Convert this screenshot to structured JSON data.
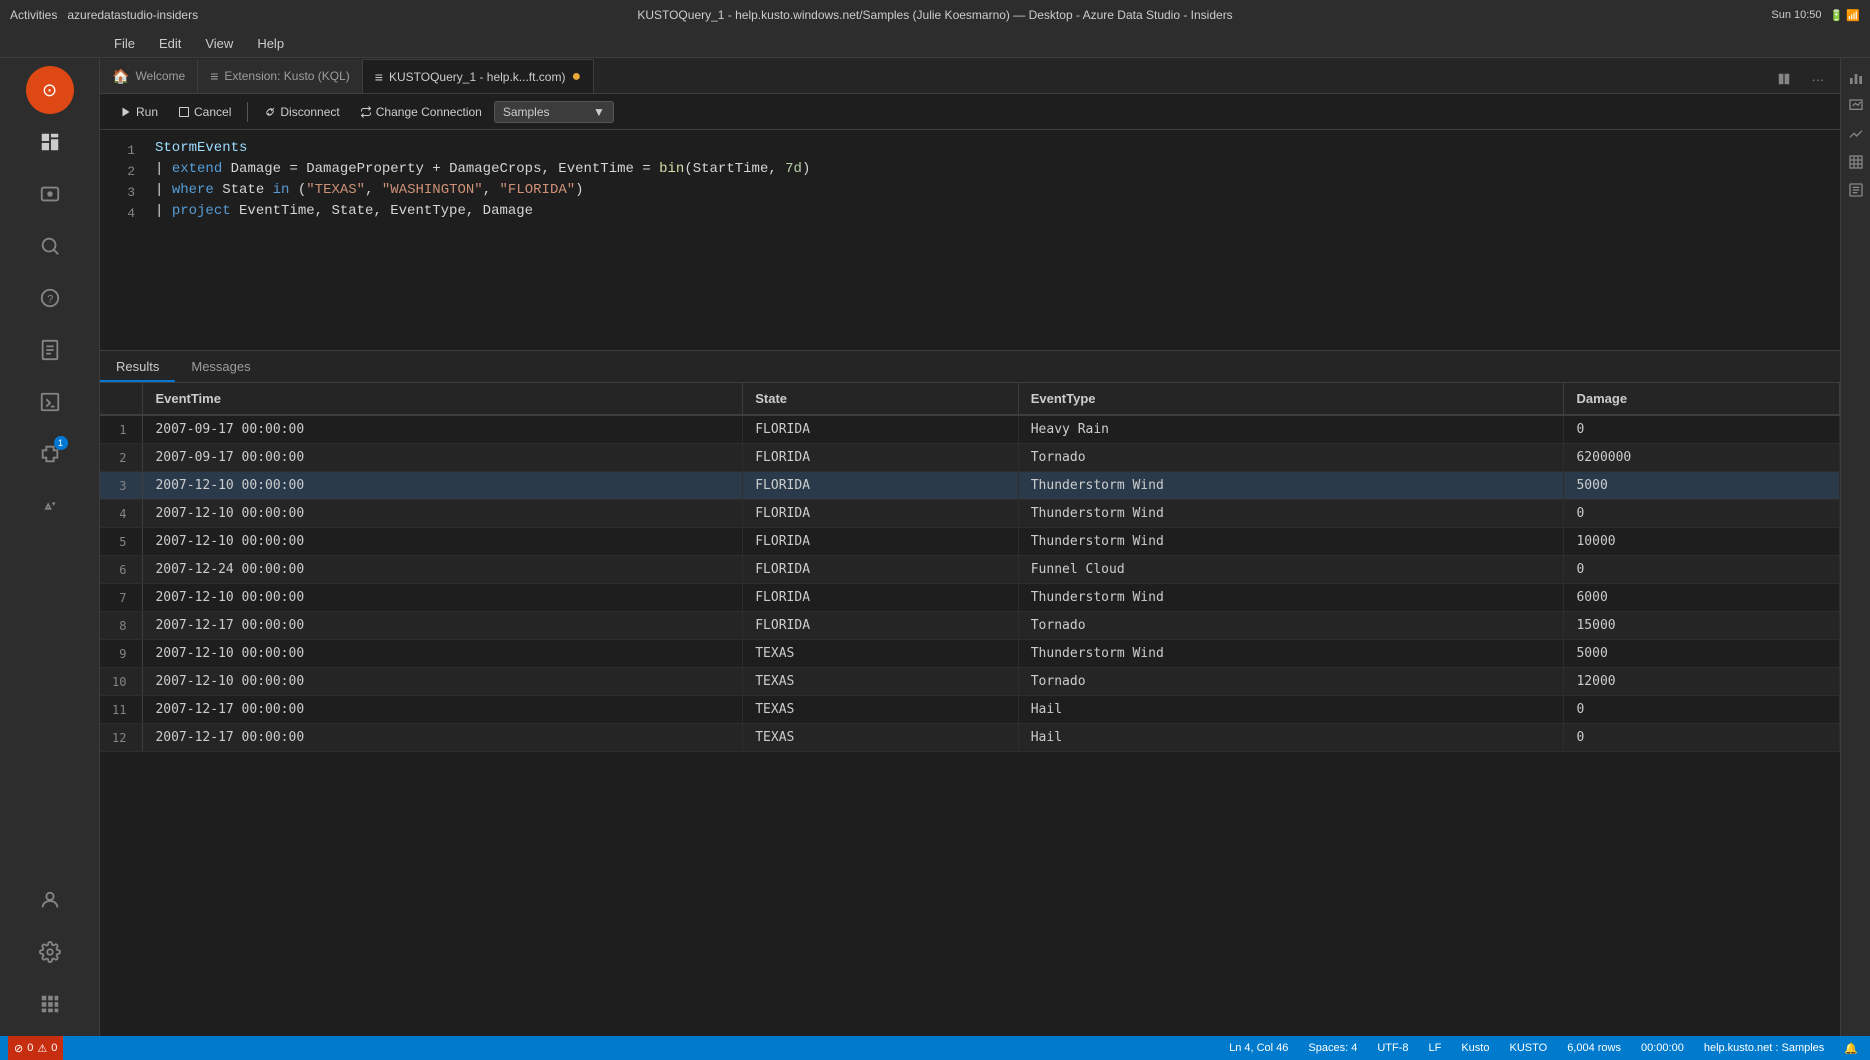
{
  "topbar": {
    "left_label": "Activities",
    "app_name": "azuredatastudio-insiders",
    "time": "Sun 10:50",
    "window_title": "KUSTOQuery_1 - help.kusto.windows.net/Samples (Julie Koesmarno) — Desktop - Azure Data Studio - Insiders"
  },
  "menu": {
    "items": [
      "File",
      "Edit",
      "View",
      "Help"
    ]
  },
  "tabs": [
    {
      "label": "Welcome",
      "icon": "🏠",
      "active": false
    },
    {
      "label": "Extension: Kusto (KQL)",
      "icon": "≡",
      "active": false
    },
    {
      "label": "KUSTOQuery_1 - help.k...ft.com)",
      "icon": "≡",
      "active": true,
      "modified": true
    }
  ],
  "toolbar": {
    "run_label": "Run",
    "cancel_label": "Cancel",
    "disconnect_label": "Disconnect",
    "change_connection_label": "Change Connection",
    "database_label": "Samples"
  },
  "code": {
    "lines": [
      {
        "num": "1",
        "content": "StormEvents"
      },
      {
        "num": "2",
        "content": "| extend Damage = DamageProperty + DamageCrops, EventTime = bin(StartTime, 7d)"
      },
      {
        "num": "3",
        "content": "| where State in (\"TEXAS\", \"WASHINGTON\", \"FLORIDA\")"
      },
      {
        "num": "4",
        "content": "| project EventTime, State, EventType, Damage"
      }
    ]
  },
  "results_tabs": [
    "Results",
    "Messages"
  ],
  "table": {
    "columns": [
      "EventTime",
      "State",
      "EventType",
      "Damage"
    ],
    "rows": [
      [
        "1",
        "2007-09-17 00:00:00",
        "FLORIDA",
        "Heavy Rain",
        "0"
      ],
      [
        "2",
        "2007-09-17 00:00:00",
        "FLORIDA",
        "Tornado",
        "6200000"
      ],
      [
        "3",
        "2007-12-10 00:00:00",
        "FLORIDA",
        "Thunderstorm Wind",
        "5000"
      ],
      [
        "4",
        "2007-12-10 00:00:00",
        "FLORIDA",
        "Thunderstorm Wind",
        "0"
      ],
      [
        "5",
        "2007-12-10 00:00:00",
        "FLORIDA",
        "Thunderstorm Wind",
        "10000"
      ],
      [
        "6",
        "2007-12-24 00:00:00",
        "FLORIDA",
        "Funnel Cloud",
        "0"
      ],
      [
        "7",
        "2007-12-10 00:00:00",
        "FLORIDA",
        "Thunderstorm Wind",
        "6000"
      ],
      [
        "8",
        "2007-12-17 00:00:00",
        "FLORIDA",
        "Tornado",
        "15000"
      ],
      [
        "9",
        "2007-12-10 00:00:00",
        "TEXAS",
        "Thunderstorm Wind",
        "5000"
      ],
      [
        "10",
        "2007-12-10 00:00:00",
        "TEXAS",
        "Tornado",
        "12000"
      ],
      [
        "11",
        "2007-12-17 00:00:00",
        "TEXAS",
        "Hail",
        "0"
      ],
      [
        "12",
        "2007-12-17 00:00:00",
        "TEXAS",
        "Hail",
        "0"
      ]
    ]
  },
  "statusbar": {
    "errors": "0",
    "warnings": "0",
    "line": "Ln 4, Col 46",
    "spaces": "Spaces: 4",
    "encoding": "UTF-8",
    "eol": "LF",
    "language": "Kusto",
    "schema": "KUSTO",
    "rows": "6,004 rows",
    "time": "00:00:00",
    "connection": "help.kusto.net : Samples"
  }
}
